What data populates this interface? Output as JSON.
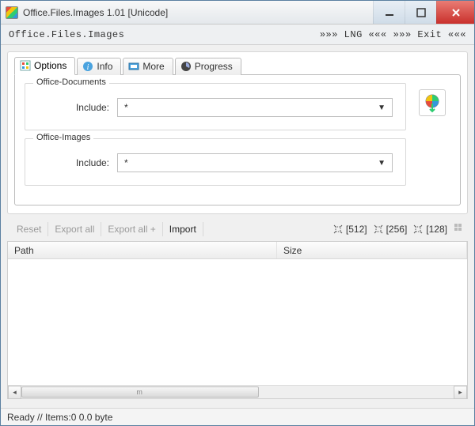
{
  "window": {
    "title": "Office.Files.Images 1.01 [Unicode]"
  },
  "subheader": {
    "title": "Office.Files.Images",
    "lng": "»»» LNG «««",
    "exit": "»»» Exit «««"
  },
  "tabs": [
    {
      "label": "Options",
      "active": true
    },
    {
      "label": "Info",
      "active": false
    },
    {
      "label": "More",
      "active": false
    },
    {
      "label": "Progress",
      "active": false
    }
  ],
  "options_panel": {
    "group_documents": {
      "legend": "Office-Documents",
      "include_label": "Include:",
      "include_value": "*"
    },
    "group_images": {
      "legend": "Office-Images",
      "include_label": "Include:",
      "include_value": "*"
    }
  },
  "toolbar": {
    "reset": "Reset",
    "export_all": "Export all",
    "export_all_plus": "Export all +",
    "import": "Import",
    "sizes": [
      "[512]",
      "[256]",
      "[128]"
    ]
  },
  "table": {
    "columns": {
      "path": "Path",
      "size": "Size"
    },
    "rows": []
  },
  "scroll_thumb_label": "m",
  "status": "Ready // Items:0 0.0 byte"
}
